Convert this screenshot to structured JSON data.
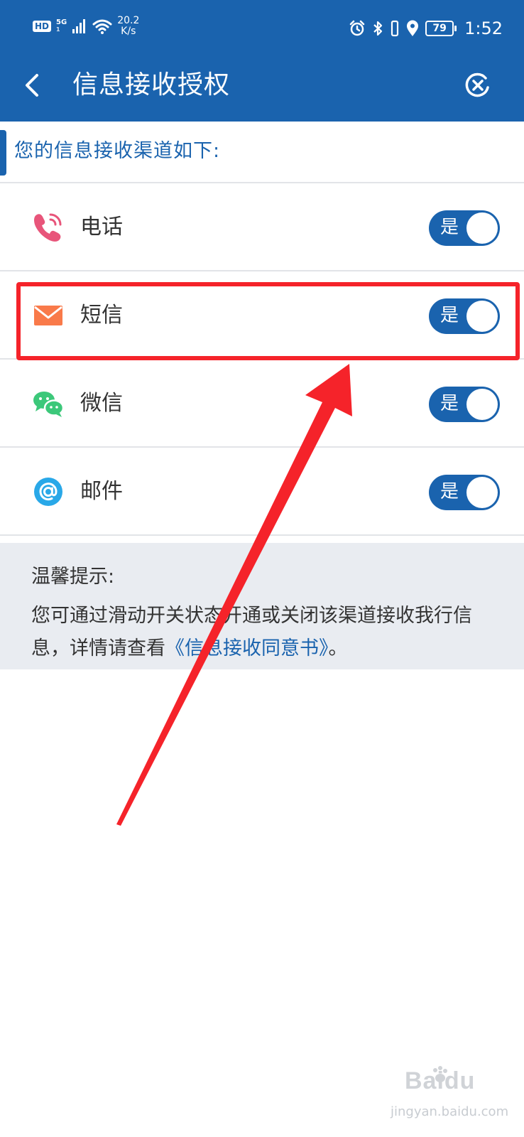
{
  "status_bar": {
    "hd": "HD",
    "net_type": "5G",
    "net_sub": "1",
    "speed_value": "20.2",
    "speed_unit": "K/s",
    "battery": "79",
    "time": "1:52"
  },
  "nav": {
    "title": "信息接收授权"
  },
  "section": {
    "label": "您的信息接收渠道如下:"
  },
  "channels": [
    {
      "name": "电话",
      "toggle_label": "是",
      "icon": "phone-icon",
      "color": "#e8557a"
    },
    {
      "name": "短信",
      "toggle_label": "是",
      "icon": "envelope-icon",
      "color": "#f97a4a"
    },
    {
      "name": "微信",
      "toggle_label": "是",
      "icon": "wechat-icon",
      "color": "#3cc87a"
    },
    {
      "name": "邮件",
      "toggle_label": "是",
      "icon": "at-sign-icon",
      "color": "#29a8e8"
    }
  ],
  "tips": {
    "title": "温馨提示:",
    "body_prefix": "您可通过滑动开关状态开通或关闭该渠道接收我行信息，详情请查看",
    "link": "《信息接收同意书》",
    "body_suffix": "。"
  },
  "watermark": {
    "brand": "Baidu",
    "sub": "jingyan.baidu.com"
  },
  "colors": {
    "primary": "#1a63ae",
    "annotation_red": "#f5232a",
    "tips_background": "#e9ecf1"
  }
}
